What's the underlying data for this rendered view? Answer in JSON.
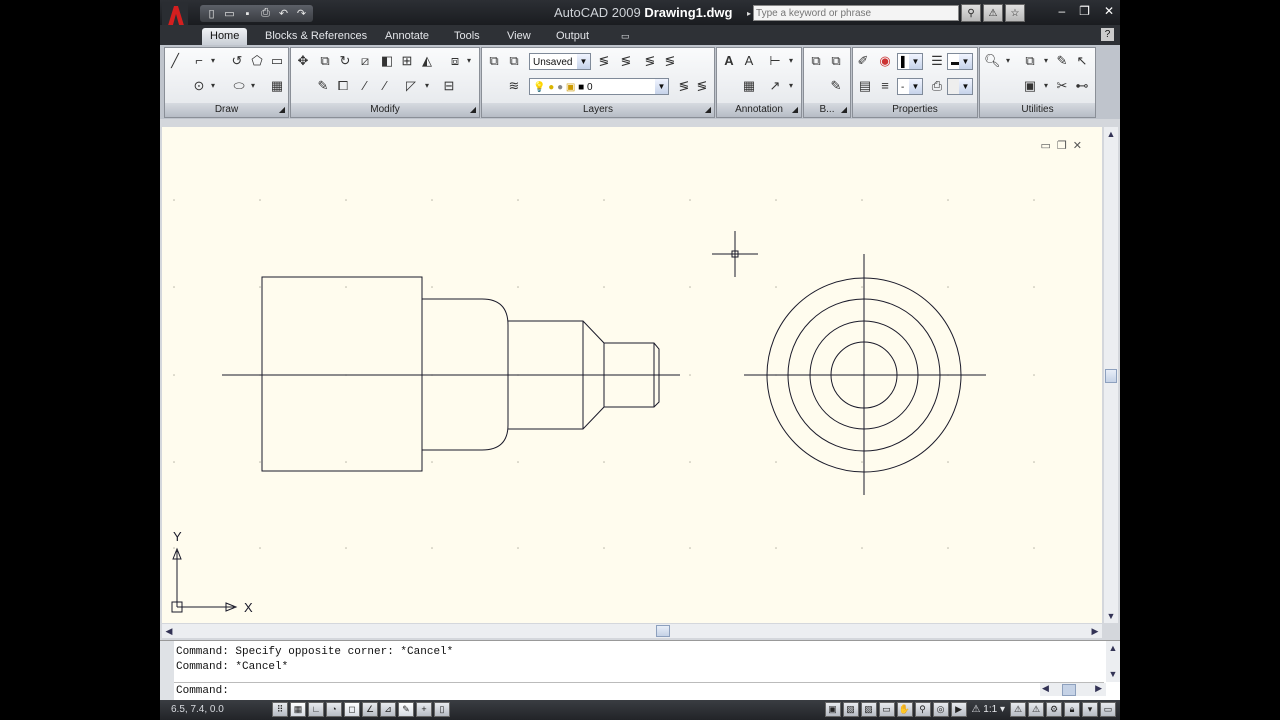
{
  "titlebar": {
    "app_name": "AutoCAD 2009",
    "document": "Drawing1.dwg",
    "search_placeholder": "Type a keyword or phrase",
    "qat_icons": [
      "new-icon",
      "open-icon",
      "save-icon",
      "plot-icon",
      "undo-icon",
      "redo-icon"
    ]
  },
  "tabs": [
    {
      "label": "Home",
      "active": true
    },
    {
      "label": "Blocks & References"
    },
    {
      "label": "Annotate"
    },
    {
      "label": "Tools"
    },
    {
      "label": "View"
    },
    {
      "label": "Output"
    }
  ],
  "panels": {
    "draw": "Draw",
    "modify": "Modify",
    "layers": "Layers",
    "annotation": "Annotation",
    "blocks": "B...",
    "properties": "Properties",
    "utilities": "Utilities"
  },
  "layers": {
    "layer_state": "Unsaved",
    "current_layer": "0"
  },
  "ucs": {
    "x_label": "X",
    "y_label": "Y"
  },
  "command": {
    "history": [
      "Command: Specify opposite corner: *Cancel*",
      "Command: *Cancel*"
    ],
    "prompt": "Command:"
  },
  "status": {
    "coordinates": "6.5, 7.4, 0.0",
    "annotation_scale": "1:1"
  },
  "colors": {
    "canvas_bg": "#fffcee",
    "geometry": "#1a1a2a",
    "ribbon_bg": "#e3e6ea",
    "titlebar_bg": "#1a1c20"
  }
}
